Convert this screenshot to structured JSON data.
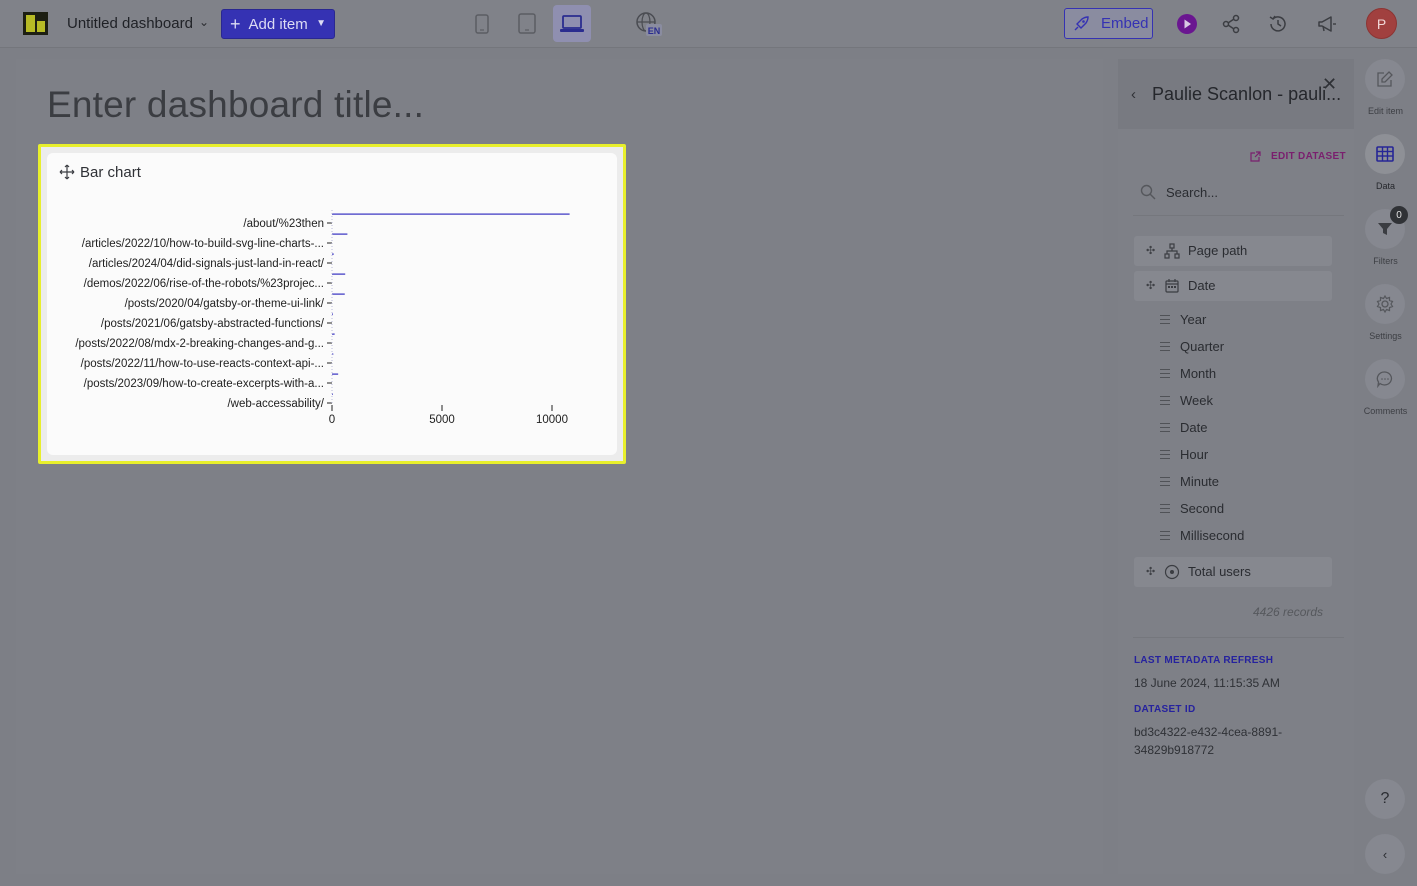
{
  "topbar": {
    "dashboard_name": "Untitled dashboard",
    "add_item_label": "Add item",
    "language_code": "EN",
    "embed_label": "Embed",
    "avatar_initial": "P",
    "accent_color": "#3532b3"
  },
  "canvas": {
    "title_placeholder": "Enter dashboard title..."
  },
  "chart_card": {
    "title": "Bar chart",
    "highlight_color": "#e8ef2c"
  },
  "chart_data": {
    "type": "bar",
    "orientation": "horizontal",
    "categories": [
      "/about/%23then",
      "/articles/2022/10/how-to-build-svg-line-charts-...",
      "/articles/2024/04/did-signals-just-land-in-react/",
      "/demos/2022/06/rise-of-the-robots/%23projec...",
      "/posts/2020/04/gatsby-or-theme-ui-link/",
      "/posts/2021/06/gatsby-abstracted-functions/",
      "/posts/2022/08/mdx-2-breaking-changes-and-g...",
      "/posts/2022/11/how-to-use-reacts-context-api-...",
      "/posts/2023/09/how-to-create-excerpts-with-a...",
      "/web-accessability/"
    ],
    "values": [
      10800,
      700,
      80,
      600,
      580,
      40,
      120,
      60,
      280,
      40
    ],
    "xticks": [
      0,
      5000,
      10000
    ],
    "xlim": [
      0,
      11500
    ],
    "bar_color": "#3530c0"
  },
  "panel": {
    "title": "Paulie Scanlon - pauli...",
    "edit_dataset_label": "EDIT DATASET",
    "search_placeholder": "Search...",
    "fields": [
      {
        "label": "Page path",
        "icon": "hierarchy-icon"
      },
      {
        "label": "Date",
        "icon": "calendar-icon"
      },
      {
        "label": "Total users",
        "icon": "number-icon"
      }
    ],
    "date_parts": [
      "Year",
      "Quarter",
      "Month",
      "Week",
      "Date",
      "Hour",
      "Minute",
      "Second",
      "Millisecond"
    ],
    "records": "4426 records",
    "last_refresh_label": "LAST METADATA REFRESH",
    "last_refresh_value": "18 June 2024, 11:15:35 AM",
    "dataset_id_label": "DATASET ID",
    "dataset_id_line1": "bd3c4322-e432-4cea-8891-",
    "dataset_id_line2": "34829b918772"
  },
  "rail": {
    "edit_item": "Edit item",
    "data": "Data",
    "filters": "Filters",
    "filters_count": "0",
    "settings": "Settings",
    "comments": "Comments",
    "help": "?"
  }
}
